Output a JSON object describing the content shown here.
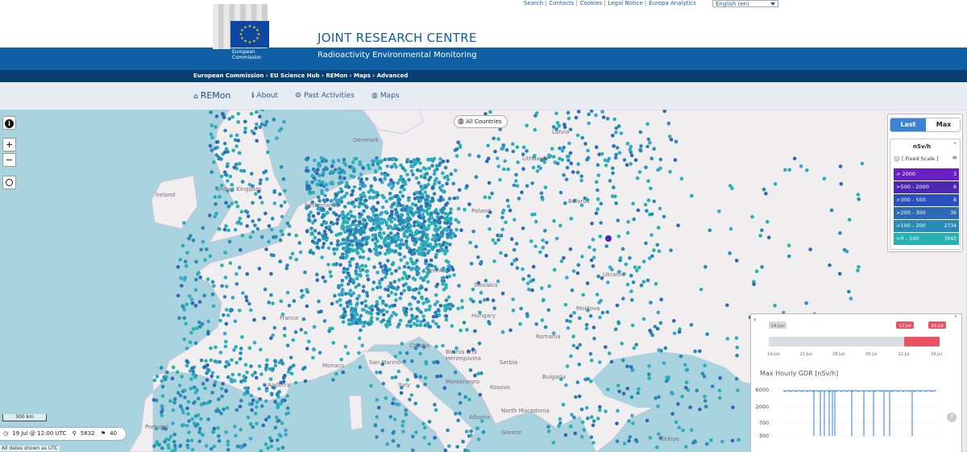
{
  "toplinks": {
    "search": "Search",
    "contacts": "Contacts",
    "cookies": "Cookies",
    "legal": "Legal Notice",
    "analytics": "Europa Analytics",
    "separator": "|",
    "language": "English (en)"
  },
  "header": {
    "logo_text": "European Commission",
    "title": "JOINT RESEARCH CENTRE",
    "subtitle": "Radioactivity Environmental Monitoring",
    "breadcrumb": "European Commission › EU Science Hub › REMon › Maps › Advanced",
    "colors": {
      "primary": "#0e5fa3",
      "dark": "#0a3f73"
    }
  },
  "nav": {
    "brand": "REMon",
    "items": [
      {
        "label": "About",
        "icon": "info-icon"
      },
      {
        "label": "Past Activities",
        "icon": "cogs-icon"
      },
      {
        "label": "Maps",
        "icon": "globe-icon"
      }
    ]
  },
  "map": {
    "all_countries": "All Countries",
    "scale": "300 km",
    "status": {
      "datetime": "19 Jul @ 12:00 UTC",
      "stations": "5832",
      "flags": "40"
    },
    "utc_note": "All dates shown as UTC",
    "labels": {
      "latvia": "Latvia",
      "lithuania": "Lithuania",
      "denmark": "Denmark",
      "belarus": "Belarus",
      "ireland": "Ireland",
      "united_kingdom": "United Kingdom",
      "netherlands": "Netherlands",
      "poland": "Poland",
      "czechia": "Czechia",
      "slovakia": "Slovakia",
      "ukraine": "Ukraine",
      "moldova": "Moldova",
      "france": "France",
      "hungary": "Hungary",
      "romania": "Romania",
      "croatia": "Croatia",
      "bosnia": "Bosnia and Herzegovina",
      "serbia": "Serbia",
      "monaco": "Monaco",
      "san_marino": "San Marino",
      "bulgaria": "Bulgaria",
      "andorra": "Andorra",
      "italy": "Italy",
      "montenegro": "Montenegro",
      "kosovo": "Kosovo",
      "north_macedonia": "North Macedonia",
      "albania": "Albania",
      "portugal": "Portugal",
      "greece": "Greece",
      "turkiye": "Türkiye"
    }
  },
  "legend": {
    "toggle_last": "Last",
    "toggle_max": "Max",
    "unit": "nSv/h",
    "scale": "[ Fixed Scale ]",
    "rows": [
      {
        "label": "> 2000",
        "count": "3",
        "color": "#6a1fc2"
      },
      {
        "label": ">500 - 2000",
        "count": "8",
        "color": "#4a28b0"
      },
      {
        "label": ">300 - 500",
        "count": "8",
        "color": "#2a4fbf"
      },
      {
        "label": ">200 - 300",
        "count": "36",
        "color": "#2d6ab3"
      },
      {
        "label": ">100 - 200",
        "count": "2734",
        "color": "#2a8ab6"
      },
      {
        "label": ">0 - 100",
        "count": "3043",
        "color": "#26b1b3"
      }
    ]
  },
  "timeline": {
    "start_badge": "14 Jun",
    "sel_start_badge": "12 Jul",
    "sel_end_badge": "19 Jul",
    "ticks": [
      "14 Jun",
      "21 Jun",
      "28 Jun",
      "05 Jul",
      "12 Jul",
      "19 Jul"
    ],
    "accent": "#e9525e"
  },
  "chart_data": {
    "type": "line",
    "title": "Max Hourly GDR [nSv/h]",
    "yticks": [
      "6000",
      "2000",
      "700",
      "300"
    ],
    "series": [
      {
        "baseline": 6000,
        "dips_to": 300,
        "color": "#2f7de1"
      }
    ]
  }
}
